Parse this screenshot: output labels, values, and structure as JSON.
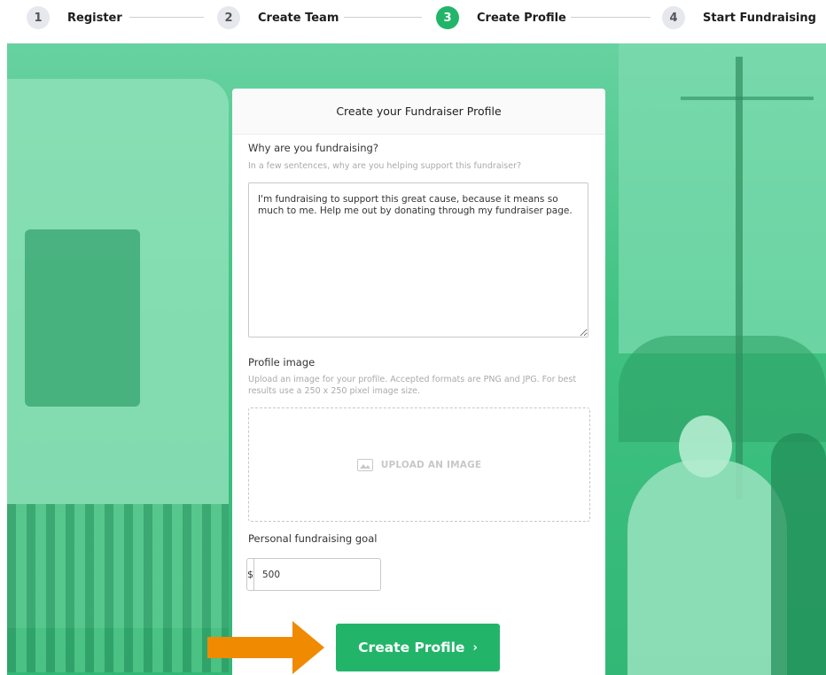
{
  "stepper": {
    "steps": [
      {
        "number": "1",
        "label": "Register"
      },
      {
        "number": "2",
        "label": "Create Team"
      },
      {
        "number": "3",
        "label": "Create Profile",
        "active": true
      },
      {
        "number": "4",
        "label": "Start Fundraising"
      }
    ]
  },
  "form": {
    "title": "Create your Fundraiser Profile",
    "why": {
      "label": "Why are you fundraising?",
      "hint": "In a few sentences, why are you helping support this fundraiser?",
      "value": "I'm fundraising to support this great cause, because it means so much to me. Help me out by donating through my fundraiser page."
    },
    "image": {
      "label": "Profile image",
      "hint": "Upload an image for your profile. Accepted formats are PNG and JPG. For best results use a 250 x 250 pixel image size.",
      "upload_label": "UPLOAD AN IMAGE"
    },
    "goal": {
      "label": "Personal fundraising goal",
      "currency": "$",
      "value": "500"
    },
    "submit_label": "Create Profile",
    "submit_chevron": "›"
  },
  "colors": {
    "accent": "#22b56a",
    "hero_tint": "#3fc282",
    "annotation_arrow": "#f08a00"
  },
  "icons": {
    "upload": "image-icon",
    "submit": "chevron-right-icon",
    "annotation": "arrow-right-icon"
  }
}
